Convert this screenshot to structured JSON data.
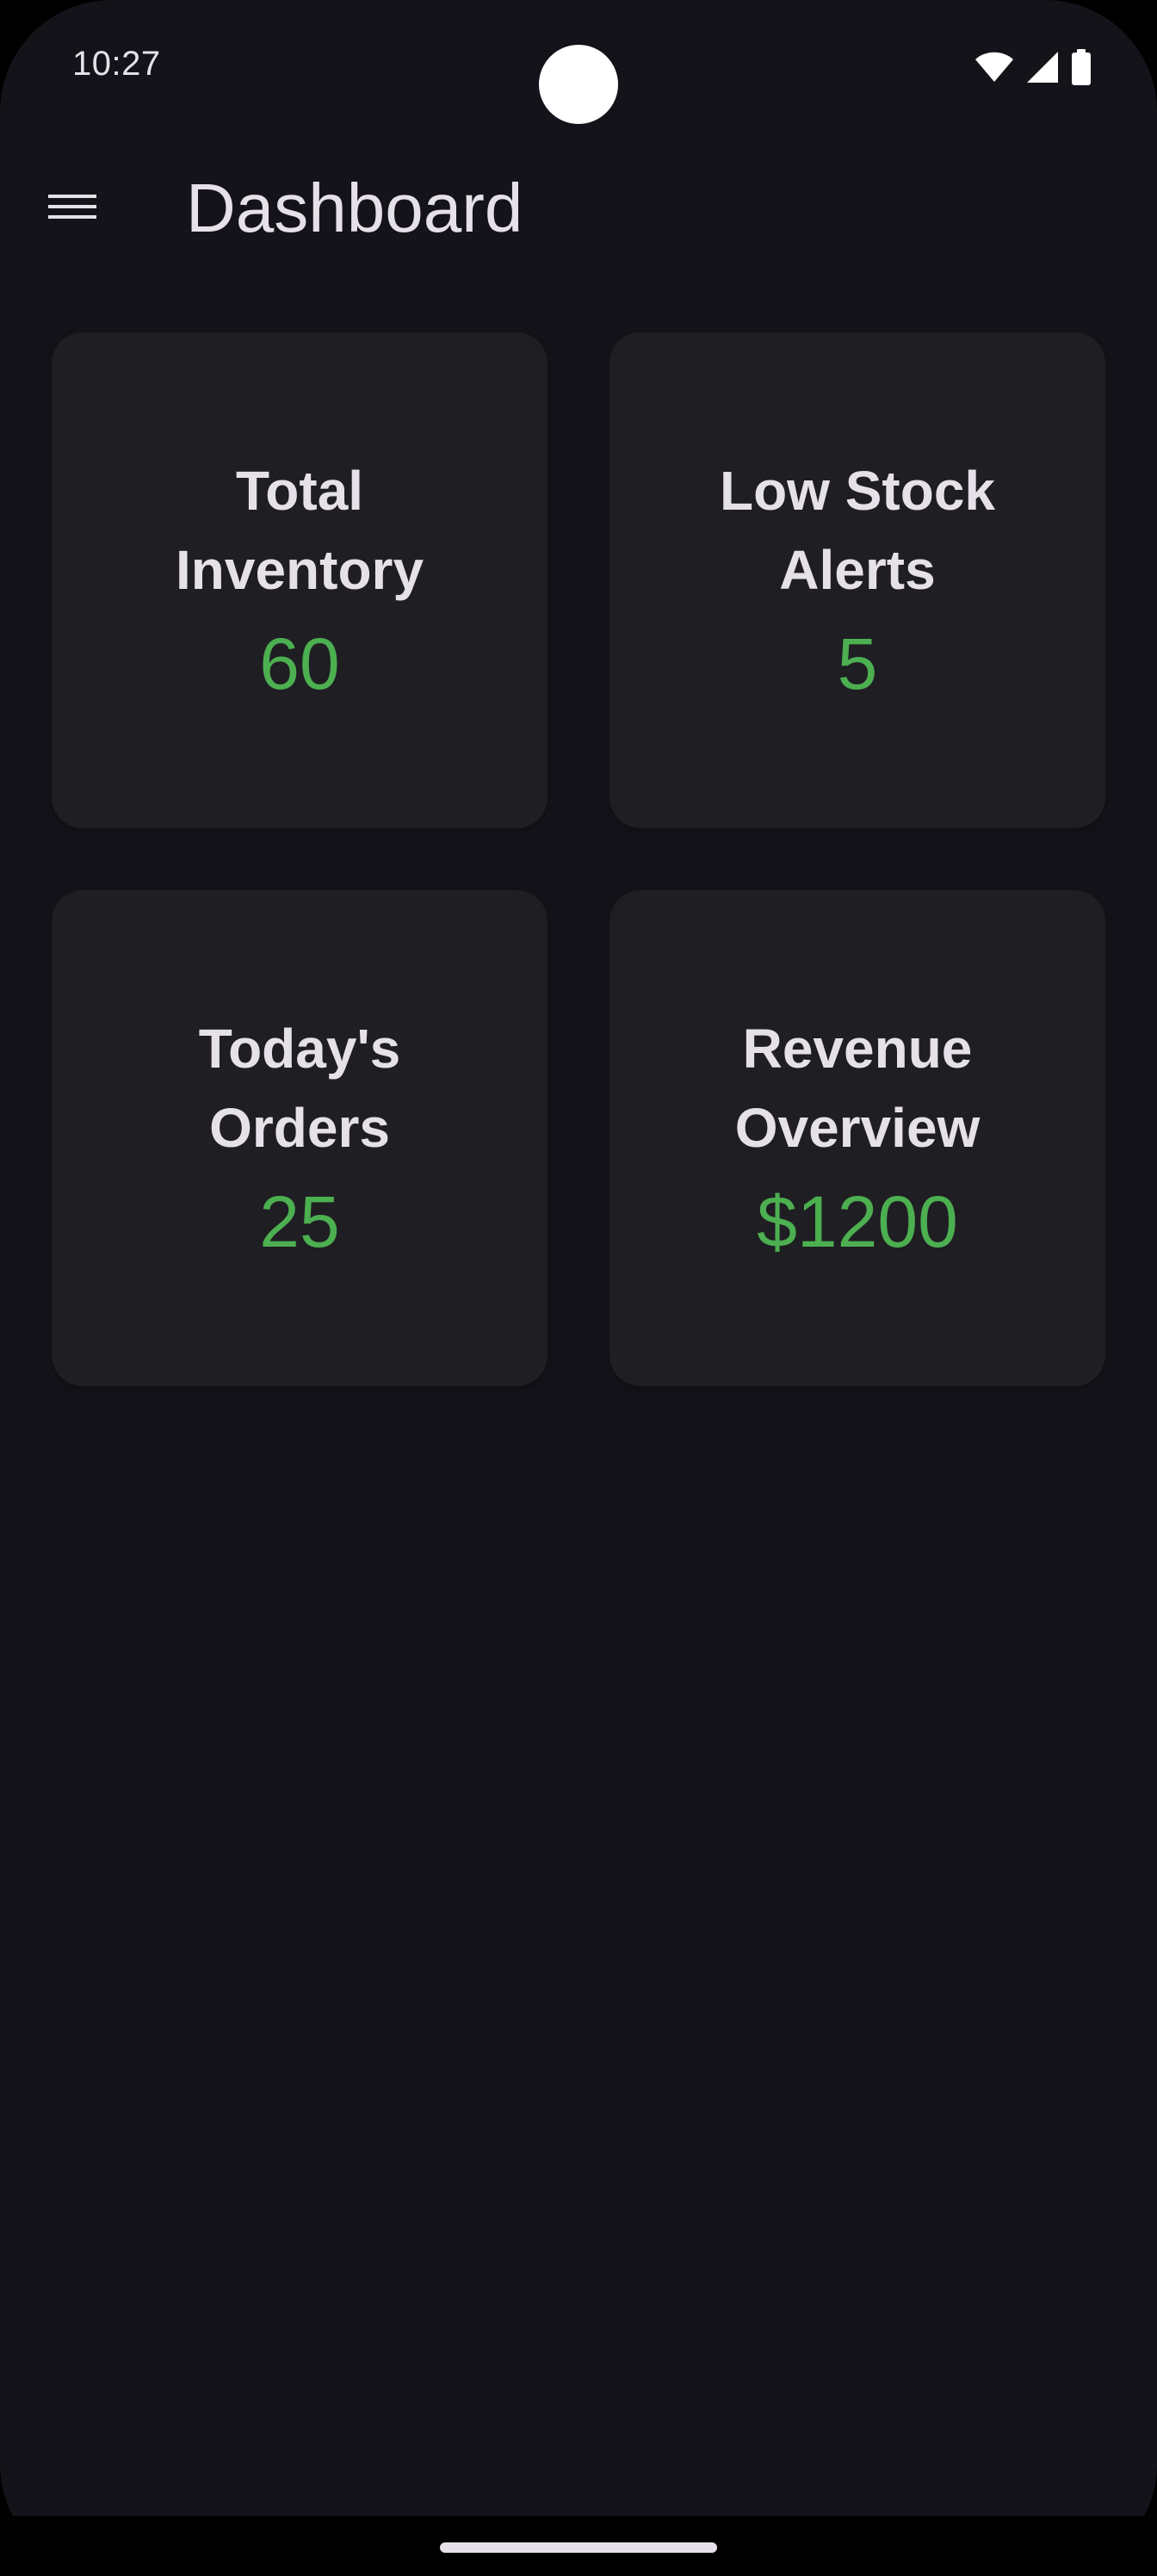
{
  "status_bar": {
    "time": "10:27",
    "icons": [
      "wifi-icon",
      "cellular-signal-icon",
      "battery-icon"
    ]
  },
  "app_bar": {
    "menu_icon": "hamburger-menu-icon",
    "title": "Dashboard"
  },
  "cards": [
    {
      "title": "Total Inventory",
      "value": "60"
    },
    {
      "title": "Low Stock Alerts",
      "value": "5"
    },
    {
      "title": "Today's Orders",
      "value": "25"
    },
    {
      "title": "Revenue Overview",
      "value": "$1200"
    }
  ],
  "colors": {
    "background": "#15131a",
    "card": "#1f1e23",
    "text": "#e6e1e9",
    "accent_value": "#4caf50"
  }
}
